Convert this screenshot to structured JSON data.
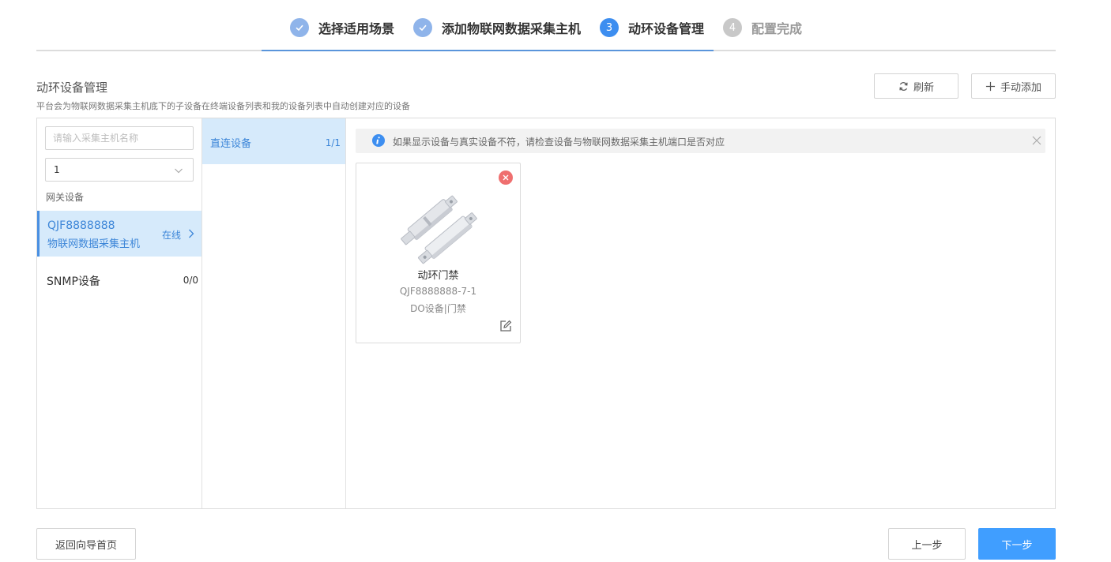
{
  "steps": [
    {
      "num": "1",
      "label": "选择适用场景",
      "state": "done"
    },
    {
      "num": "2",
      "label": "添加物联网数据采集主机",
      "state": "done"
    },
    {
      "num": "3",
      "label": "动环设备管理",
      "state": "active"
    },
    {
      "num": "4",
      "label": "配置完成",
      "state": "todo"
    }
  ],
  "header": {
    "title": "动环设备管理",
    "description": "平台会为物联网数据采集主机底下的子设备在终端设备列表和我的设备列表中自动创建对应的设备",
    "refresh_label": "刷新",
    "manual_add_label": "手动添加"
  },
  "left_panel": {
    "search_placeholder": "请输入采集主机名称",
    "select_value": "1",
    "group_label": "网关设备",
    "gateway": {
      "id": "QJF8888888",
      "name": "物联网数据采集主机",
      "status": "在线"
    },
    "snmp": {
      "name": "SNMP设备",
      "count": "0/0"
    }
  },
  "middle_panel": {
    "direct_label": "直连设备",
    "direct_count": "1/1"
  },
  "notice": {
    "text": "如果显示设备与真实设备不符，请检查设备与物联网数据采集主机端口是否对应"
  },
  "device_card": {
    "title": "动环门禁",
    "serial": "QJF8888888-7-1",
    "type": "DO设备|门禁"
  },
  "footer": {
    "back_home_label": "返回向导首页",
    "prev_label": "上一步",
    "next_label": "下一步"
  },
  "colors": {
    "accent": "#409eff",
    "step_done": "#8fb4ea",
    "step_active": "#3d8ef0",
    "selected_bg": "#d6eafb",
    "delete": "#ef6f6f"
  }
}
